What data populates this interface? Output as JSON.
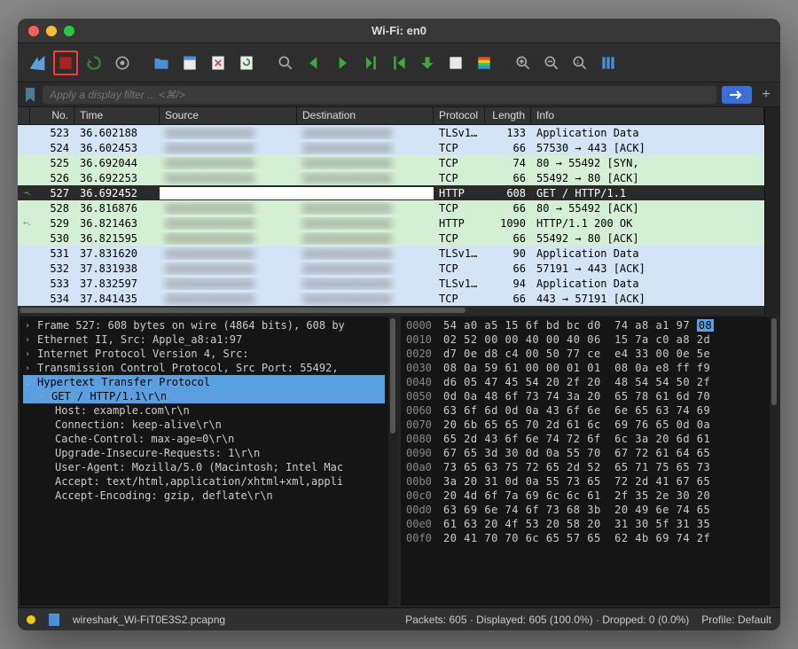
{
  "window": {
    "title": "Wi-Fi: en0"
  },
  "filter": {
    "placeholder": "Apply a display filter ... <⌘/>"
  },
  "columns": {
    "no": "No.",
    "time": "Time",
    "source": "Source",
    "destination": "Destination",
    "protocol": "Protocol",
    "length": "Length",
    "info": "Info"
  },
  "packets": [
    {
      "no": "523",
      "time": "36.602188",
      "proto": "TLSv1…",
      "len": "133",
      "info": "Application Data",
      "bg": "bg-lightblue"
    },
    {
      "no": "524",
      "time": "36.602453",
      "proto": "TCP",
      "len": "66",
      "info": "57530 → 443 [ACK]",
      "bg": "bg-lightblue"
    },
    {
      "no": "525",
      "time": "36.692044",
      "proto": "TCP",
      "len": "74",
      "info": "80 → 55492 [SYN,",
      "bg": "bg-lightgreen"
    },
    {
      "no": "526",
      "time": "36.692253",
      "proto": "TCP",
      "len": "66",
      "info": "55492 → 80 [ACK]",
      "bg": "bg-lightgreen"
    },
    {
      "no": "527",
      "time": "36.692452",
      "proto": "HTTP",
      "len": "608",
      "info": "GET / HTTP/1.1",
      "bg": "bg-selected",
      "arrow": "→"
    },
    {
      "no": "528",
      "time": "36.816876",
      "proto": "TCP",
      "len": "66",
      "info": "80 → 55492 [ACK]",
      "bg": "bg-lightgreen"
    },
    {
      "no": "529",
      "time": "36.821463",
      "proto": "HTTP",
      "len": "1090",
      "info": "HTTP/1.1 200 OK",
      "bg": "bg-lightgreen",
      "arrow": "←"
    },
    {
      "no": "530",
      "time": "36.821595",
      "proto": "TCP",
      "len": "66",
      "info": "55492 → 80 [ACK]",
      "bg": "bg-lightgreen"
    },
    {
      "no": "531",
      "time": "37.831620",
      "proto": "TLSv1…",
      "len": "90",
      "info": "Application Data",
      "bg": "bg-lightblue"
    },
    {
      "no": "532",
      "time": "37.831938",
      "proto": "TCP",
      "len": "66",
      "info": "57191 → 443 [ACK]",
      "bg": "bg-lightblue"
    },
    {
      "no": "533",
      "time": "37.832597",
      "proto": "TLSv1…",
      "len": "94",
      "info": "Application Data",
      "bg": "bg-lightblue"
    },
    {
      "no": "534",
      "time": "37.841435",
      "proto": "TCP",
      "len": "66",
      "info": "443 → 57191 [ACK]",
      "bg": "bg-lightblue"
    }
  ],
  "tree": [
    {
      "label": "Frame 527: 608 bytes on wire (4864 bits), 608 by",
      "disc": "›"
    },
    {
      "label": "Ethernet II, Src: Apple_a8:a1:97",
      "disc": "›"
    },
    {
      "label": "Internet Protocol Version 4, Src:",
      "disc": "›"
    },
    {
      "label": "Transmission Control Protocol, Src Port: 55492,",
      "disc": "›"
    },
    {
      "label": "Hypertext Transfer Protocol",
      "disc": "⌄",
      "hl": true
    },
    {
      "label": "GET / HTTP/1.1\\r\\n",
      "disc": "›",
      "hlchild": true
    },
    {
      "label": "Host: example.com\\r\\n",
      "child": true
    },
    {
      "label": "Connection: keep-alive\\r\\n",
      "child": true
    },
    {
      "label": "Cache-Control: max-age=0\\r\\n",
      "child": true
    },
    {
      "label": "Upgrade-Insecure-Requests: 1\\r\\n",
      "child": true
    },
    {
      "label": "User-Agent: Mozilla/5.0 (Macintosh; Intel Mac",
      "child": true
    },
    {
      "label": "Accept: text/html,application/xhtml+xml,appli",
      "child": true
    },
    {
      "label": "Accept-Encoding: gzip, deflate\\r\\n",
      "child": true
    }
  ],
  "hex": [
    {
      "off": "0000",
      "bytes": "54 a0 a5 15 6f bd bc d0  74 a8 a1 97 ",
      "hlbyte": "08"
    },
    {
      "off": "0010",
      "bytes": "02 52 00 00 40 00 40 06  15 7a c0 a8 2d"
    },
    {
      "off": "0020",
      "bytes": "d7 0e d8 c4 00 50 77 ce  e4 33 00 0e 5e"
    },
    {
      "off": "0030",
      "bytes": "08 0a 59 61 00 00 01 01  08 0a e8 ff f9"
    },
    {
      "off": "0040",
      "bytes": "d6 05 47 45 54 20 2f 20  48 54 54 50 2f"
    },
    {
      "off": "0050",
      "bytes": "0d 0a 48 6f 73 74 3a 20  65 78 61 6d 70"
    },
    {
      "off": "0060",
      "bytes": "63 6f 6d 0d 0a 43 6f 6e  6e 65 63 74 69"
    },
    {
      "off": "0070",
      "bytes": "20 6b 65 65 70 2d 61 6c  69 76 65 0d 0a"
    },
    {
      "off": "0080",
      "bytes": "65 2d 43 6f 6e 74 72 6f  6c 3a 20 6d 61"
    },
    {
      "off": "0090",
      "bytes": "67 65 3d 30 0d 0a 55 70  67 72 61 64 65"
    },
    {
      "off": "00a0",
      "bytes": "73 65 63 75 72 65 2d 52  65 71 75 65 73"
    },
    {
      "off": "00b0",
      "bytes": "3a 20 31 0d 0a 55 73 65  72 2d 41 67 65"
    },
    {
      "off": "00c0",
      "bytes": "20 4d 6f 7a 69 6c 6c 61  2f 35 2e 30 20"
    },
    {
      "off": "00d0",
      "bytes": "63 69 6e 74 6f 73 68 3b  20 49 6e 74 65"
    },
    {
      "off": "00e0",
      "bytes": "61 63 20 4f 53 20 58 20  31 30 5f 31 35"
    },
    {
      "off": "00f0",
      "bytes": "20 41 70 70 6c 65 57 65  62 4b 69 74 2f"
    }
  ],
  "status": {
    "file": "wireshark_Wi-FiT0E3S2.pcapng",
    "stats": "Packets: 605 · Displayed: 605 (100.0%) · Dropped: 0 (0.0%)",
    "profile": "Profile: Default"
  }
}
